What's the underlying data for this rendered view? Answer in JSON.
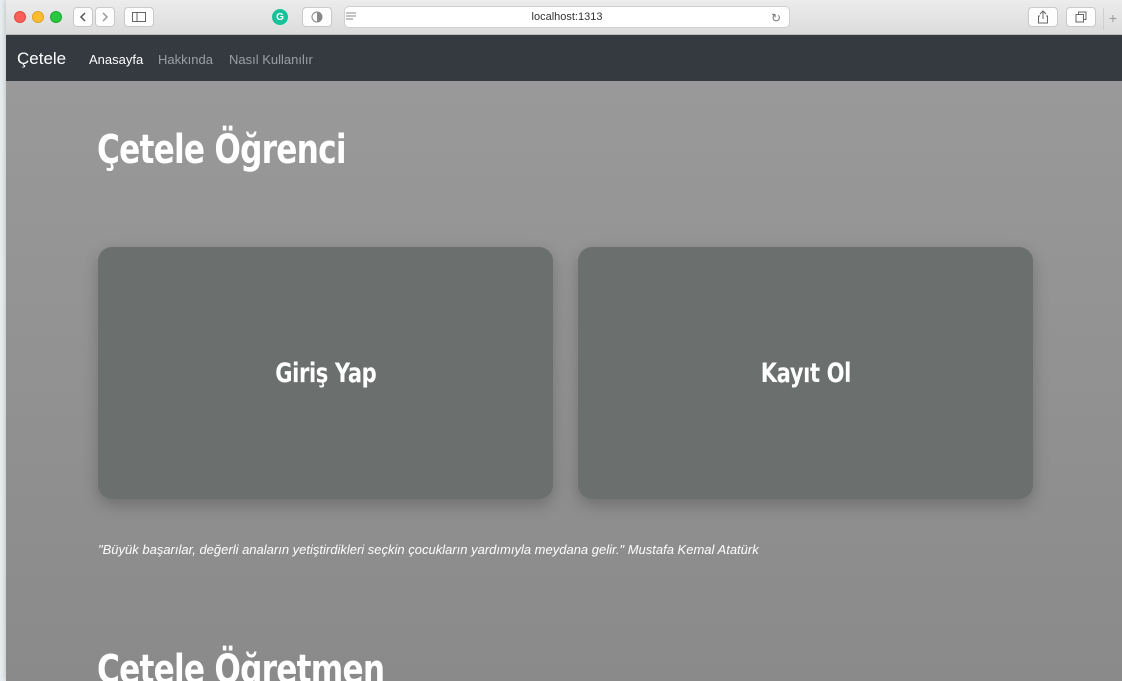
{
  "browser": {
    "url": "localhost:1313"
  },
  "navbar": {
    "brand": "Çetele",
    "links": [
      {
        "label": "Anasayfa"
      },
      {
        "label": "Hakkında"
      },
      {
        "label": "Nasıl Kullanılır"
      }
    ]
  },
  "student_section": {
    "title": "Çetele Öğrenci",
    "login_label": "Giriş Yap",
    "register_label": "Kayıt Ol"
  },
  "quote": "\"Büyük başarılar, değerli anaların yetiştirdikleri seçkin çocukların yardımıyla meydana gelir.\" Mustafa Kemal Atatürk",
  "teacher_section": {
    "title": "Çetele Öğretmen"
  },
  "colors": {
    "navbar": "#343a40",
    "card": "#6b706f",
    "background": "#8f8f8f"
  }
}
